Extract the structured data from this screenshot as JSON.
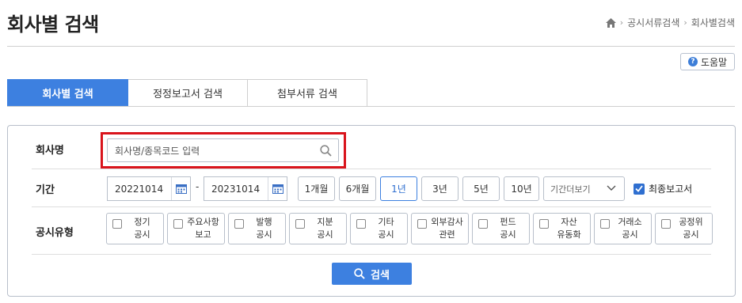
{
  "header": {
    "title": "회사별 검색",
    "breadcrumb": [
      "공시서류검색",
      "회사별검색"
    ]
  },
  "help": {
    "label": "도움말"
  },
  "tabs": [
    {
      "label": "회사별 검색",
      "active": true
    },
    {
      "label": "정정보고서 검색",
      "active": false
    },
    {
      "label": "첨부서류 검색",
      "active": false
    }
  ],
  "form": {
    "company": {
      "label": "회사명",
      "placeholder": "회사명/종목코드 입력"
    },
    "period": {
      "label": "기간",
      "start": "20221014",
      "end": "20231014",
      "separator": "-",
      "buttons": [
        "1개월",
        "6개월",
        "1년",
        "3년",
        "5년",
        "10년"
      ],
      "selected": "1년",
      "more_select": "기간더보기",
      "final_report_label": "최종보고서",
      "final_report_checked": true
    },
    "disclosure_type": {
      "label": "공시유형",
      "options": [
        {
          "line1": "정기",
          "line2": "공시"
        },
        {
          "line1": "주요사항",
          "line2": "보고"
        },
        {
          "line1": "발행",
          "line2": "공시"
        },
        {
          "line1": "지분",
          "line2": "공시"
        },
        {
          "line1": "기타",
          "line2": "공시"
        },
        {
          "line1": "외부감사",
          "line2": "관련"
        },
        {
          "line1": "펀드",
          "line2": "공시"
        },
        {
          "line1": "자산",
          "line2": "유동화"
        },
        {
          "line1": "거래소",
          "line2": "공시"
        },
        {
          "line1": "공정위",
          "line2": "공시"
        }
      ]
    },
    "search_button": "검색"
  },
  "colors": {
    "accent": "#3d80e0",
    "highlight": "#d9141c"
  }
}
